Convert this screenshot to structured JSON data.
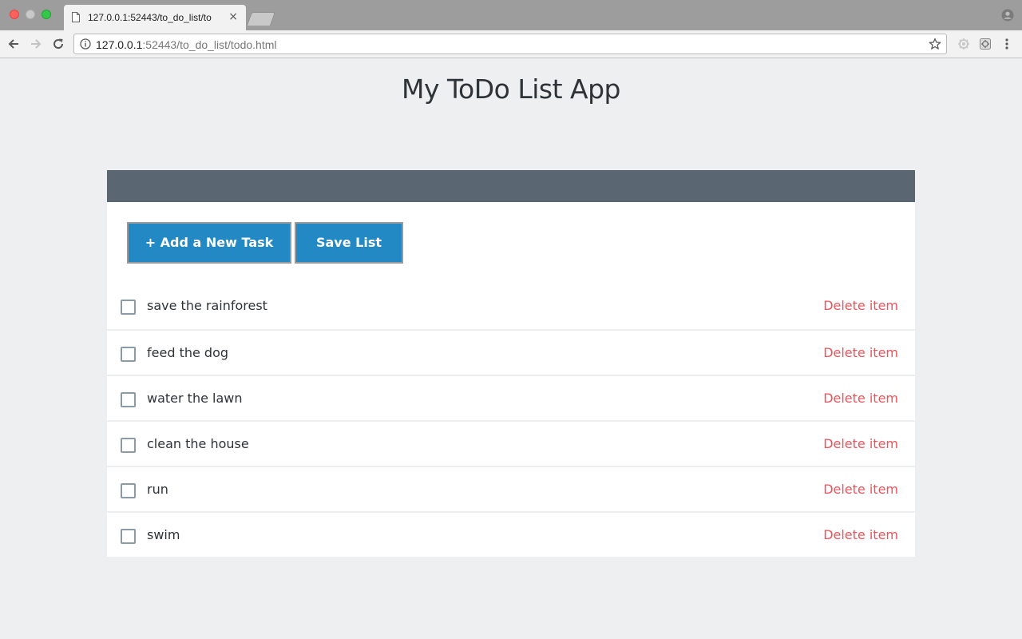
{
  "browser": {
    "tab_title": "127.0.0.1:52443/to_do_list/todo.html",
    "tab_title_shown": "127.0.0.1:52443/to_do_list/to",
    "close_glyph": "×",
    "url_host": "127.0.0.1",
    "url_rest": ":52443/to_do_list/todo.html",
    "icons": [
      "document-icon",
      "close-icon",
      "profile-icon",
      "back-icon",
      "forward-icon",
      "reload-icon",
      "info-icon",
      "star-icon",
      "extension-icon",
      "menu-icon"
    ]
  },
  "app": {
    "title": "My ToDo List App",
    "add_button": "+ Add a New Task",
    "save_button": "Save List",
    "delete_label": "Delete item",
    "colors": {
      "header_bar": "#5a6773",
      "button": "#2389c4",
      "delete": "#f0525a",
      "background": "#eeeff1"
    }
  },
  "tasks": [
    {
      "label": "save the rainforest",
      "checked": false
    },
    {
      "label": "feed the dog",
      "checked": false
    },
    {
      "label": "water the lawn",
      "checked": false
    },
    {
      "label": "clean the house",
      "checked": false
    },
    {
      "label": "run",
      "checked": false
    },
    {
      "label": "swim",
      "checked": false
    }
  ]
}
